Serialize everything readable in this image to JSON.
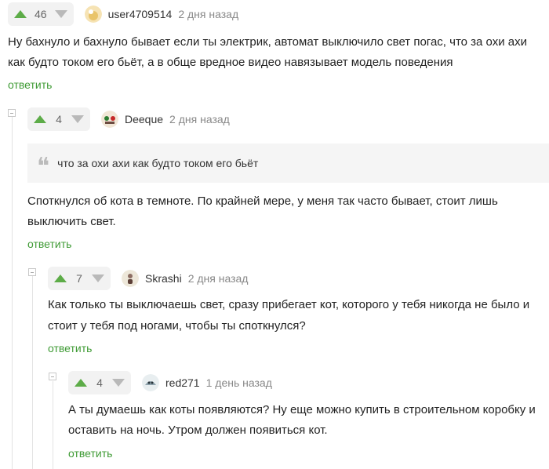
{
  "comments": [
    {
      "votes": "46",
      "user": "user4709514",
      "time": "2 дня назад",
      "lines": [
        "Ну бахнуло и бахнуло бывает если ты электрик, автомат выключило свет погас, что за охи ахи",
        "как будто током его бьёт, а в обще вредное видео навязывает модель поведения"
      ],
      "reply": "ответить"
    },
    {
      "votes": "4",
      "user": "Deeque",
      "time": "2 дня назад",
      "quote": "что за охи ахи как будто током его бьёт",
      "lines": [
        "Споткнулся об кота в темноте. По крайней мере, у меня так часто бывает, стоит лишь",
        "выключить свет."
      ],
      "reply": "ответить"
    },
    {
      "votes": "7",
      "user": "Skrashi",
      "time": "2 дня назад",
      "lines": [
        "Как только ты выключаешь свет, сразу прибегает кот, которого у тебя никогда не было и",
        "стоит у тебя под ногами, чтобы ты споткнулся?"
      ],
      "reply": "ответить"
    },
    {
      "votes": "4",
      "user": "red271",
      "time": "1 день назад",
      "lines": [
        "А ты думаешь как коты появляются? Ну еще можно купить в строительном коробку и",
        "оставить на ночь. Утром должен появиться кот."
      ],
      "reply": "ответить"
    }
  ],
  "colors": {
    "accent": "#3f9b35",
    "upvote": "#5dac48",
    "downvote": "#b9b9b9"
  },
  "icons": {
    "up": "arrow-up-icon",
    "down": "arrow-down-icon",
    "quote": "quote-icon",
    "collapse": "collapse-icon"
  }
}
